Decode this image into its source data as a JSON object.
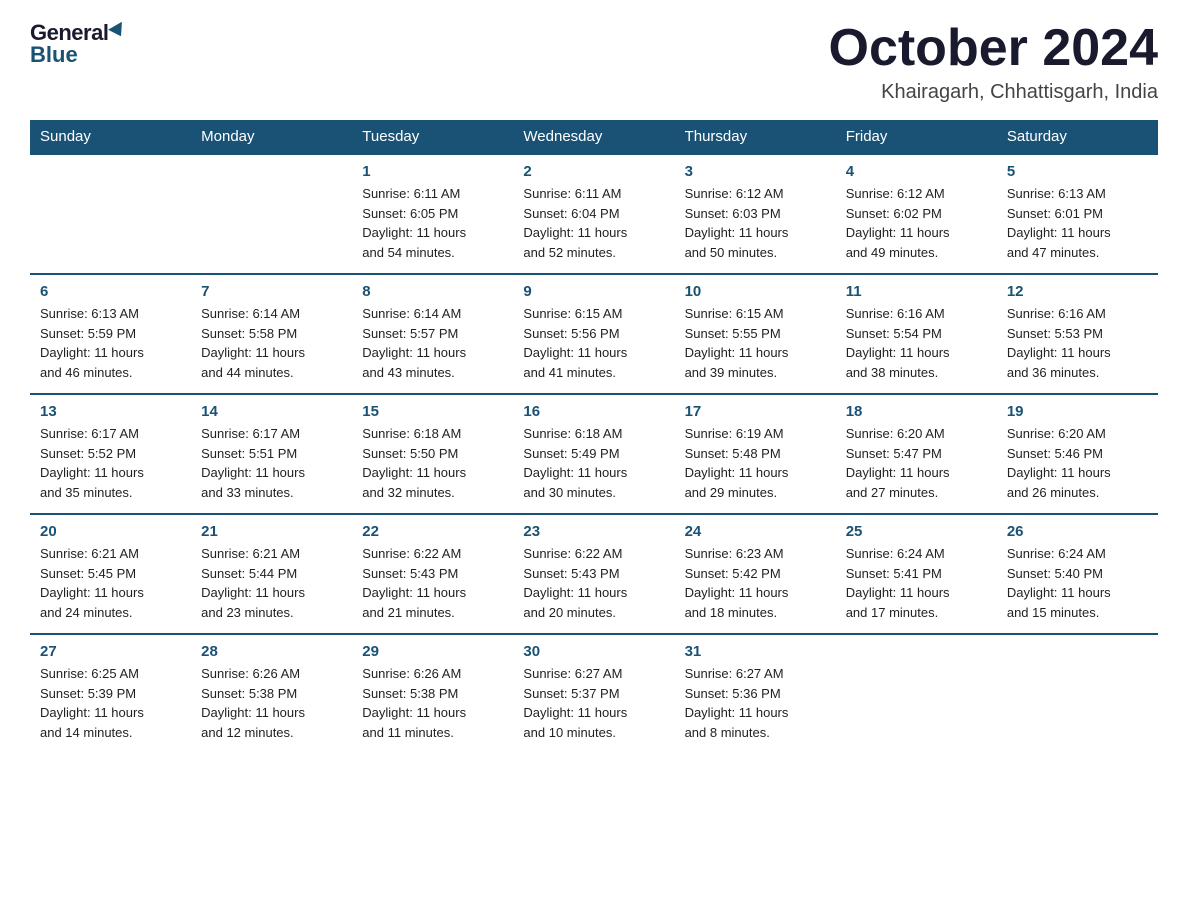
{
  "logo": {
    "general": "General",
    "blue": "Blue"
  },
  "header": {
    "month": "October 2024",
    "location": "Khairagarh, Chhattisgarh, India"
  },
  "days_of_week": [
    "Sunday",
    "Monday",
    "Tuesday",
    "Wednesday",
    "Thursday",
    "Friday",
    "Saturday"
  ],
  "weeks": [
    [
      {
        "day": "",
        "info": ""
      },
      {
        "day": "",
        "info": ""
      },
      {
        "day": "1",
        "info": "Sunrise: 6:11 AM\nSunset: 6:05 PM\nDaylight: 11 hours\nand 54 minutes."
      },
      {
        "day": "2",
        "info": "Sunrise: 6:11 AM\nSunset: 6:04 PM\nDaylight: 11 hours\nand 52 minutes."
      },
      {
        "day": "3",
        "info": "Sunrise: 6:12 AM\nSunset: 6:03 PM\nDaylight: 11 hours\nand 50 minutes."
      },
      {
        "day": "4",
        "info": "Sunrise: 6:12 AM\nSunset: 6:02 PM\nDaylight: 11 hours\nand 49 minutes."
      },
      {
        "day": "5",
        "info": "Sunrise: 6:13 AM\nSunset: 6:01 PM\nDaylight: 11 hours\nand 47 minutes."
      }
    ],
    [
      {
        "day": "6",
        "info": "Sunrise: 6:13 AM\nSunset: 5:59 PM\nDaylight: 11 hours\nand 46 minutes."
      },
      {
        "day": "7",
        "info": "Sunrise: 6:14 AM\nSunset: 5:58 PM\nDaylight: 11 hours\nand 44 minutes."
      },
      {
        "day": "8",
        "info": "Sunrise: 6:14 AM\nSunset: 5:57 PM\nDaylight: 11 hours\nand 43 minutes."
      },
      {
        "day": "9",
        "info": "Sunrise: 6:15 AM\nSunset: 5:56 PM\nDaylight: 11 hours\nand 41 minutes."
      },
      {
        "day": "10",
        "info": "Sunrise: 6:15 AM\nSunset: 5:55 PM\nDaylight: 11 hours\nand 39 minutes."
      },
      {
        "day": "11",
        "info": "Sunrise: 6:16 AM\nSunset: 5:54 PM\nDaylight: 11 hours\nand 38 minutes."
      },
      {
        "day": "12",
        "info": "Sunrise: 6:16 AM\nSunset: 5:53 PM\nDaylight: 11 hours\nand 36 minutes."
      }
    ],
    [
      {
        "day": "13",
        "info": "Sunrise: 6:17 AM\nSunset: 5:52 PM\nDaylight: 11 hours\nand 35 minutes."
      },
      {
        "day": "14",
        "info": "Sunrise: 6:17 AM\nSunset: 5:51 PM\nDaylight: 11 hours\nand 33 minutes."
      },
      {
        "day": "15",
        "info": "Sunrise: 6:18 AM\nSunset: 5:50 PM\nDaylight: 11 hours\nand 32 minutes."
      },
      {
        "day": "16",
        "info": "Sunrise: 6:18 AM\nSunset: 5:49 PM\nDaylight: 11 hours\nand 30 minutes."
      },
      {
        "day": "17",
        "info": "Sunrise: 6:19 AM\nSunset: 5:48 PM\nDaylight: 11 hours\nand 29 minutes."
      },
      {
        "day": "18",
        "info": "Sunrise: 6:20 AM\nSunset: 5:47 PM\nDaylight: 11 hours\nand 27 minutes."
      },
      {
        "day": "19",
        "info": "Sunrise: 6:20 AM\nSunset: 5:46 PM\nDaylight: 11 hours\nand 26 minutes."
      }
    ],
    [
      {
        "day": "20",
        "info": "Sunrise: 6:21 AM\nSunset: 5:45 PM\nDaylight: 11 hours\nand 24 minutes."
      },
      {
        "day": "21",
        "info": "Sunrise: 6:21 AM\nSunset: 5:44 PM\nDaylight: 11 hours\nand 23 minutes."
      },
      {
        "day": "22",
        "info": "Sunrise: 6:22 AM\nSunset: 5:43 PM\nDaylight: 11 hours\nand 21 minutes."
      },
      {
        "day": "23",
        "info": "Sunrise: 6:22 AM\nSunset: 5:43 PM\nDaylight: 11 hours\nand 20 minutes."
      },
      {
        "day": "24",
        "info": "Sunrise: 6:23 AM\nSunset: 5:42 PM\nDaylight: 11 hours\nand 18 minutes."
      },
      {
        "day": "25",
        "info": "Sunrise: 6:24 AM\nSunset: 5:41 PM\nDaylight: 11 hours\nand 17 minutes."
      },
      {
        "day": "26",
        "info": "Sunrise: 6:24 AM\nSunset: 5:40 PM\nDaylight: 11 hours\nand 15 minutes."
      }
    ],
    [
      {
        "day": "27",
        "info": "Sunrise: 6:25 AM\nSunset: 5:39 PM\nDaylight: 11 hours\nand 14 minutes."
      },
      {
        "day": "28",
        "info": "Sunrise: 6:26 AM\nSunset: 5:38 PM\nDaylight: 11 hours\nand 12 minutes."
      },
      {
        "day": "29",
        "info": "Sunrise: 6:26 AM\nSunset: 5:38 PM\nDaylight: 11 hours\nand 11 minutes."
      },
      {
        "day": "30",
        "info": "Sunrise: 6:27 AM\nSunset: 5:37 PM\nDaylight: 11 hours\nand 10 minutes."
      },
      {
        "day": "31",
        "info": "Sunrise: 6:27 AM\nSunset: 5:36 PM\nDaylight: 11 hours\nand 8 minutes."
      },
      {
        "day": "",
        "info": ""
      },
      {
        "day": "",
        "info": ""
      }
    ]
  ]
}
